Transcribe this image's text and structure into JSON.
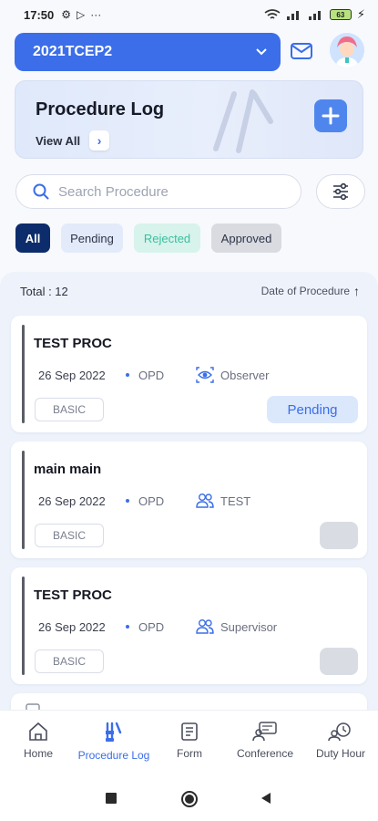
{
  "status_bar": {
    "time": "17:50",
    "battery": "63"
  },
  "header": {
    "course": "2021TCEP2"
  },
  "banner": {
    "title": "Procedure Log",
    "view_all": "View All"
  },
  "search": {
    "placeholder": "Search Procedure"
  },
  "filters": [
    "All",
    "Pending",
    "Rejected",
    "Approved"
  ],
  "list": {
    "total_label": "Total : 12",
    "sort_label": "Date of  Procedure",
    "sort_arrow": "↑",
    "items": [
      {
        "title": "TEST PROC",
        "date": "26 Sep 2022",
        "location": "OPD",
        "role_icon": "eye-icon",
        "role": "Observer",
        "level": "BASIC",
        "status": "Pending"
      },
      {
        "title": "main main",
        "date": "26 Sep 2022",
        "location": "OPD",
        "role_icon": "users-icon",
        "role": "TEST",
        "level": "BASIC",
        "status": ""
      },
      {
        "title": "TEST PROC",
        "date": "26 Sep 2022",
        "location": "OPD",
        "role_icon": "users-icon",
        "role": "Supervisor",
        "level": "BASIC",
        "status": ""
      }
    ]
  },
  "nav": {
    "home": "Home",
    "procedure_log": "Procedure Log",
    "form": "Form",
    "conference": "Conference",
    "duty_hour": "Duty Hour"
  },
  "colors": {
    "primary": "#3b6ee8",
    "dark_navy": "#0d2c6b",
    "rejected": "#3cbf9d"
  }
}
